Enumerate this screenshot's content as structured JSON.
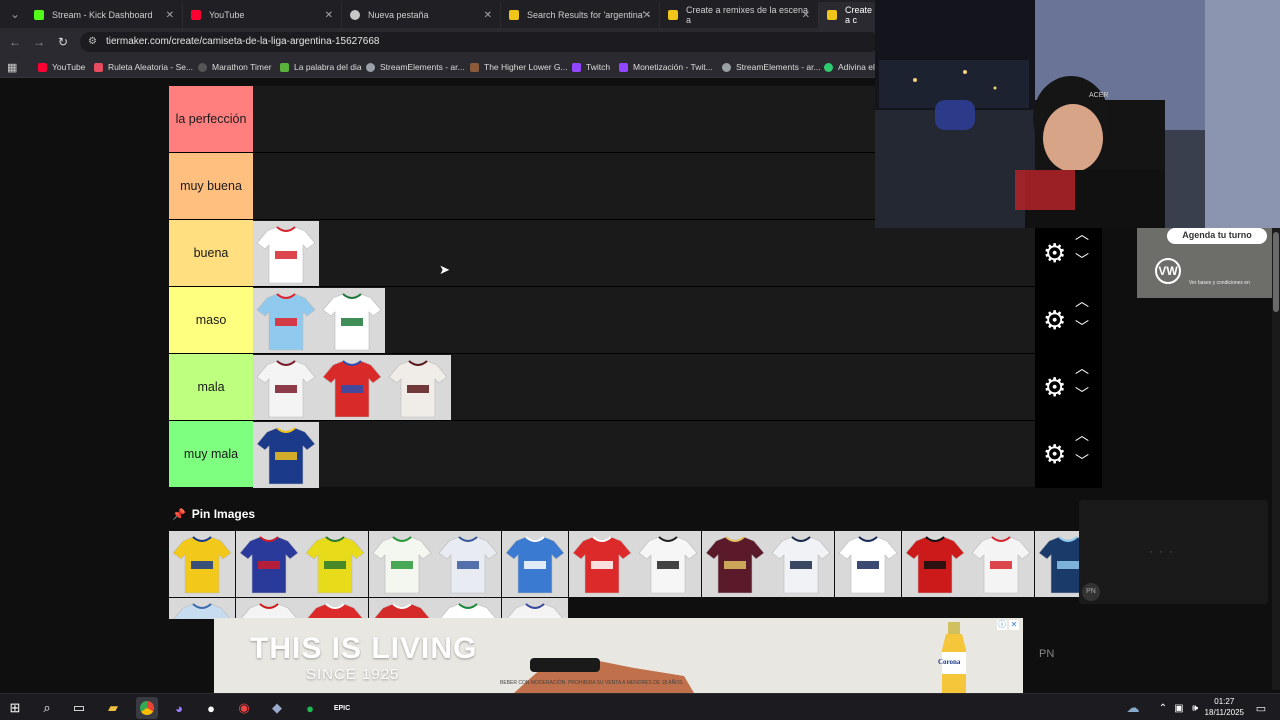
{
  "tabs": [
    {
      "title": "Stream - Kick Dashboard",
      "color": "#53fc18"
    },
    {
      "title": "YouTube",
      "color": "#ff0033"
    },
    {
      "title": "Nueva pestaña",
      "color": "#c8c8c8"
    },
    {
      "title": "Search Results for 'argentina' -",
      "color": "#f0c419"
    },
    {
      "title": "Create a remixes de la escena a",
      "color": "#f0c419"
    },
    {
      "title": "Create a c",
      "color": "#f0c419"
    }
  ],
  "address": {
    "url": "tiermaker.com/create/camiseta-de-la-liga-argentina-15627668"
  },
  "bookmarks": [
    {
      "label": "YouTube",
      "color": "#ff0033"
    },
    {
      "label": "Ruleta Aleatoria - Se...",
      "color": "#e84a5f"
    },
    {
      "label": "Marathon Timer",
      "color": "#333333"
    },
    {
      "label": "La palabra del dia",
      "color": "#5bb33b"
    },
    {
      "label": "StreamElements - ar...",
      "color": "#9aa0a6"
    },
    {
      "label": "The Higher Lower G...",
      "color": "#8a5a3a"
    },
    {
      "label": "Twitch",
      "color": "#9146ff"
    },
    {
      "label": "Monetización - Twit...",
      "color": "#9146ff"
    },
    {
      "label": "StreamElements - ar...",
      "color": "#9aa0a6"
    },
    {
      "label": "Adivina el",
      "color": "#2ecc71"
    }
  ],
  "tiers": [
    {
      "label": "la perfección",
      "color": "#ff7f7f",
      "items": []
    },
    {
      "label": "muy buena",
      "color": "#ffbf7f",
      "items": []
    },
    {
      "label": "buena",
      "color": "#ffdf7f",
      "items": [
        {
          "name": "huracan-white-jersey",
          "main": "#ffffff",
          "accent": "#d8262f"
        }
      ]
    },
    {
      "label": "maso",
      "color": "#ffff7f",
      "items": [
        {
          "name": "river-light-blue-jersey",
          "main": "#8fc9ee",
          "accent": "#e0222c"
        },
        {
          "name": "banfield-white-green-jersey",
          "main": "#ffffff",
          "accent": "#1f7a3a"
        }
      ]
    },
    {
      "label": "mala",
      "color": "#bfff7f",
      "items": [
        {
          "name": "lanus-white-jersey",
          "main": "#f4f4f4",
          "accent": "#7a1a2a"
        },
        {
          "name": "independiente-red-jersey",
          "main": "#d92a2a",
          "accent": "#2a4fb0"
        },
        {
          "name": "platense-white-jersey",
          "main": "#f0ece8",
          "accent": "#5a1a1a"
        }
      ]
    },
    {
      "label": "muy mala",
      "color": "#7fff7f",
      "items": [
        {
          "name": "boca-blue-gold-jersey",
          "main": "#1c3a8a",
          "accent": "#f2c21a"
        }
      ]
    }
  ],
  "pin": {
    "title": "Pin Images"
  },
  "pin_items": [
    {
      "name": "rosario-central-jersey",
      "main": "#f2c81a",
      "accent": "#1a3a8a"
    },
    {
      "name": "san-lorenzo-jersey",
      "main": "#2a3a9a",
      "accent": "#cc1a2a"
    },
    {
      "name": "defensa-yellow-jersey",
      "main": "#e8dc1a",
      "accent": "#2a7a2a"
    },
    {
      "name": "defensa-white-jersey",
      "main": "#f4f6f0",
      "accent": "#2a9a3a"
    },
    {
      "name": "velez-white-jersey",
      "main": "#e8ecf2",
      "accent": "#3a5aa0"
    },
    {
      "name": "godoy-cruz-jersey",
      "main": "#3a7ad0",
      "accent": "#ffffff"
    },
    {
      "name": "huracan-red-jersey",
      "main": "#dc2a2a",
      "accent": "#ffffff"
    },
    {
      "name": "estudiantes-white-jersey",
      "main": "#f6f6f6",
      "accent": "#222222"
    },
    {
      "name": "lanus-maroon-jersey",
      "main": "#5a1a2a",
      "accent": "#e0c060"
    },
    {
      "name": "gimnasia-white-jersey",
      "main": "#f0f2f6",
      "accent": "#1a2a4a"
    },
    {
      "name": "gimnasia-stripe-jersey",
      "main": "#ffffff",
      "accent": "#1a2a5a"
    },
    {
      "name": "newells-jersey",
      "main": "#cc1a1a",
      "accent": "#111111"
    },
    {
      "name": "estudiantes-red-stripe-jersey",
      "main": "#f4f4f4",
      "accent": "#d8262f"
    },
    {
      "name": "racing-blue-jersey",
      "main": "#1a3a6a",
      "accent": "#8fc9ee"
    },
    {
      "name": "argentinos-blue-white-jersey",
      "main": "#c8dcf0",
      "accent": "#3a6ab0"
    },
    {
      "name": "independiente-white-jersey",
      "main": "#f4f4f4",
      "accent": "#cc1a1a"
    },
    {
      "name": "union-red-jersey",
      "main": "#dc2a2a",
      "accent": "#ffffff"
    },
    {
      "name": "argentinos-red-jersey",
      "main": "#d42a2a",
      "accent": "#ffffff"
    },
    {
      "name": "aldosivi-jersey",
      "main": "#ffffff",
      "accent": "#1a8a3a"
    },
    {
      "name": "tigre-jersey",
      "main": "#f4f4f4",
      "accent": "#3a4aa0"
    }
  ],
  "ad": {
    "title": "THIS IS LIVING",
    "subtitle": "SINCE 1925",
    "legal": "BEBER CON MODERACIÓN. PROHIBIDA SU VENTA A MENORES DE 18 AÑOS.",
    "brand": "Corona"
  },
  "side_ad": {
    "text": "Agenda tu turno",
    "small": "Ver bases y condiciones en"
  },
  "taskbar": {
    "time": "01:27",
    "date": "18/11/2025"
  },
  "watermark": {
    "badge1": "PN",
    "badge2": "PN"
  },
  "webcam": {
    "monitor_brand": "ACER"
  }
}
